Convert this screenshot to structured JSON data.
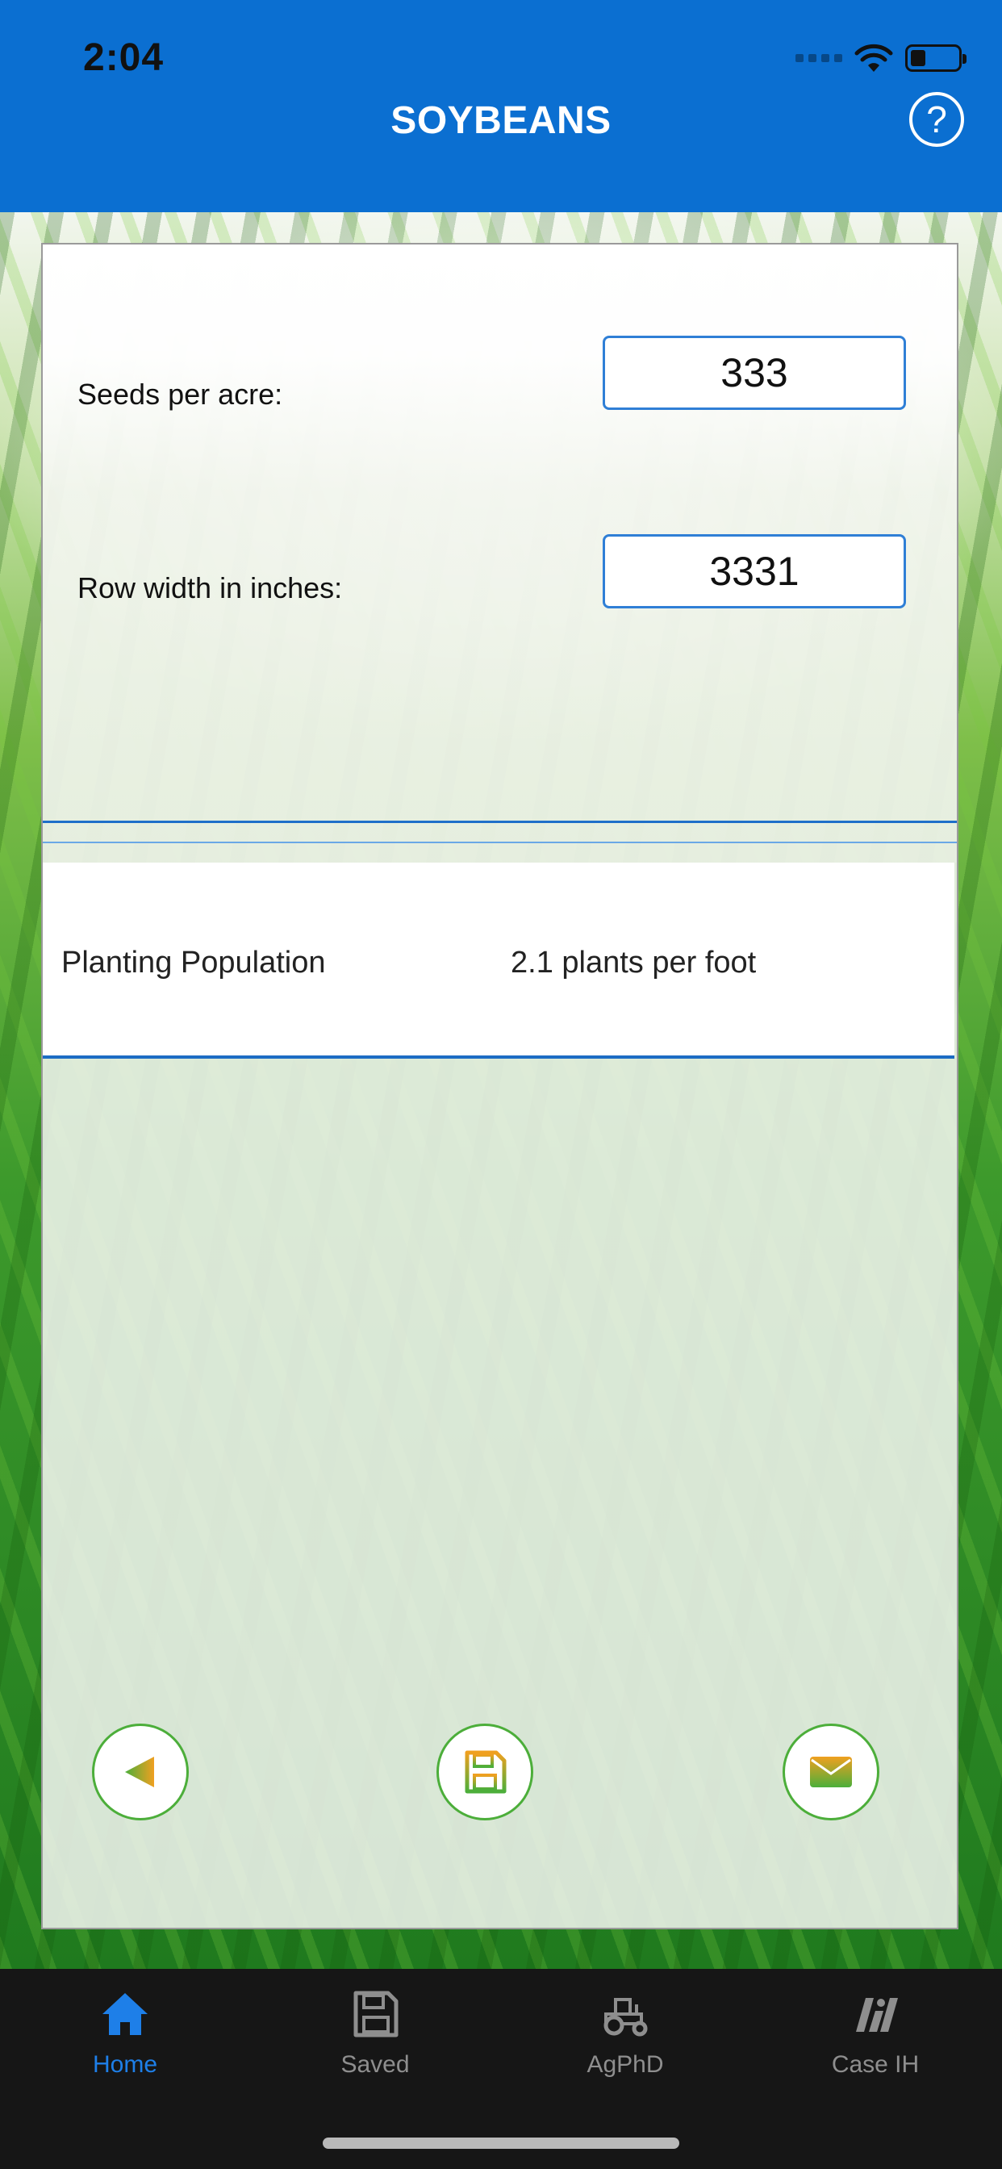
{
  "status_bar": {
    "time": "2:04"
  },
  "header": {
    "title": "SOYBEANS",
    "help_label": "?"
  },
  "form": {
    "seeds_label": "Seeds per acre:",
    "seeds_value": "333",
    "row_width_label": "Row width in inches:",
    "row_width_value": "3331"
  },
  "result": {
    "label": "Planting Population",
    "value": "2.1 plants per foot"
  },
  "actions": {
    "back_icon": "back-triangle-icon",
    "save_icon": "floppy-disk-icon",
    "email_icon": "envelope-icon"
  },
  "tabs": [
    {
      "label": "Home",
      "icon": "home-icon",
      "active": true
    },
    {
      "label": "Saved",
      "icon": "floppy-disk-icon",
      "active": false
    },
    {
      "label": "AgPhD",
      "icon": "tractor-icon",
      "active": false
    },
    {
      "label": "Case IH",
      "icon": "case-ih-logo-icon",
      "active": false
    }
  ],
  "colors": {
    "header_blue": "#0b6fd1",
    "accent_blue": "#1e7fe8",
    "button_green": "#4cae3a",
    "button_orange": "#f0a020",
    "tab_bar": "#161616"
  }
}
